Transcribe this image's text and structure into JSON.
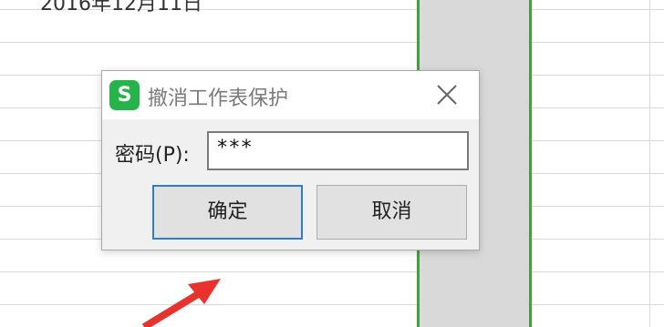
{
  "sheet": {
    "top_cell_text": "2016年12月11日"
  },
  "dialog": {
    "app_icon_letter": "S",
    "title": "撤消工作表保护",
    "password_label": "密码(P):",
    "password_value": "***",
    "ok_label": "确定",
    "cancel_label": "取消"
  },
  "colors": {
    "selection_border": "#3fa23b",
    "selected_column_fill": "#d9d9d9",
    "app_icon": "#24b44b",
    "ok_focus_border": "#2f7bd4",
    "arrow": "#e8322c"
  },
  "icons": {
    "close": "close-icon",
    "annotation": "red-arrow-icon"
  }
}
